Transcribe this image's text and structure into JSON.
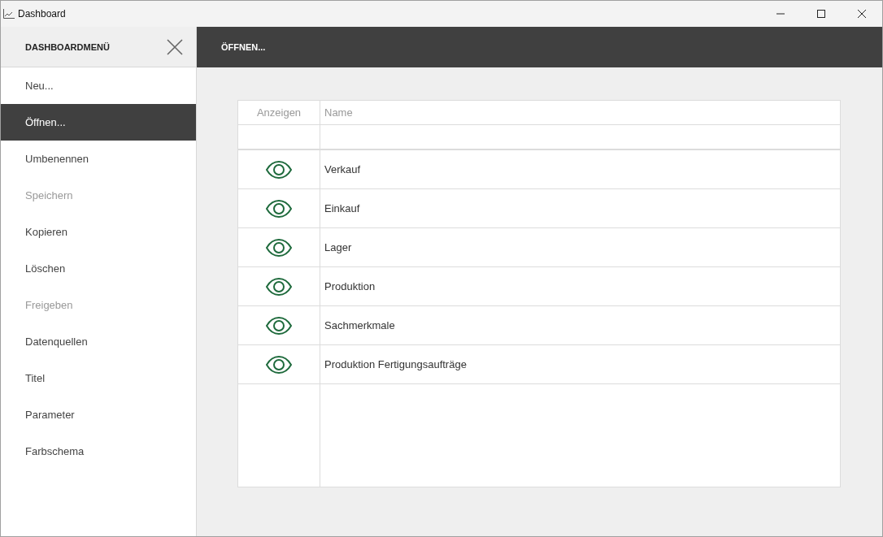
{
  "window": {
    "title": "Dashboard"
  },
  "sidebar": {
    "title": "DASHBOARDMENÜ",
    "items": [
      {
        "label": "Neu...",
        "selected": false,
        "disabled": false
      },
      {
        "label": "Öffnen...",
        "selected": true,
        "disabled": false
      },
      {
        "label": "Umbenennen",
        "selected": false,
        "disabled": false
      },
      {
        "label": "Speichern",
        "selected": false,
        "disabled": true
      },
      {
        "label": "Kopieren",
        "selected": false,
        "disabled": false
      },
      {
        "label": "Löschen",
        "selected": false,
        "disabled": false
      },
      {
        "label": "Freigeben",
        "selected": false,
        "disabled": true
      },
      {
        "label": "Datenquellen",
        "selected": false,
        "disabled": false
      },
      {
        "label": "Titel",
        "selected": false,
        "disabled": false
      },
      {
        "label": "Parameter",
        "selected": false,
        "disabled": false
      },
      {
        "label": "Farbschema",
        "selected": false,
        "disabled": false
      }
    ]
  },
  "header": {
    "title": "ÖFFNEN..."
  },
  "table": {
    "columns": [
      "Anzeigen",
      "Name"
    ],
    "rows": [
      {
        "name": "Verkauf"
      },
      {
        "name": "Einkauf"
      },
      {
        "name": "Lager"
      },
      {
        "name": "Produktion"
      },
      {
        "name": "Sachmerkmale"
      },
      {
        "name": "Produktion Fertigungsaufträge"
      }
    ]
  }
}
